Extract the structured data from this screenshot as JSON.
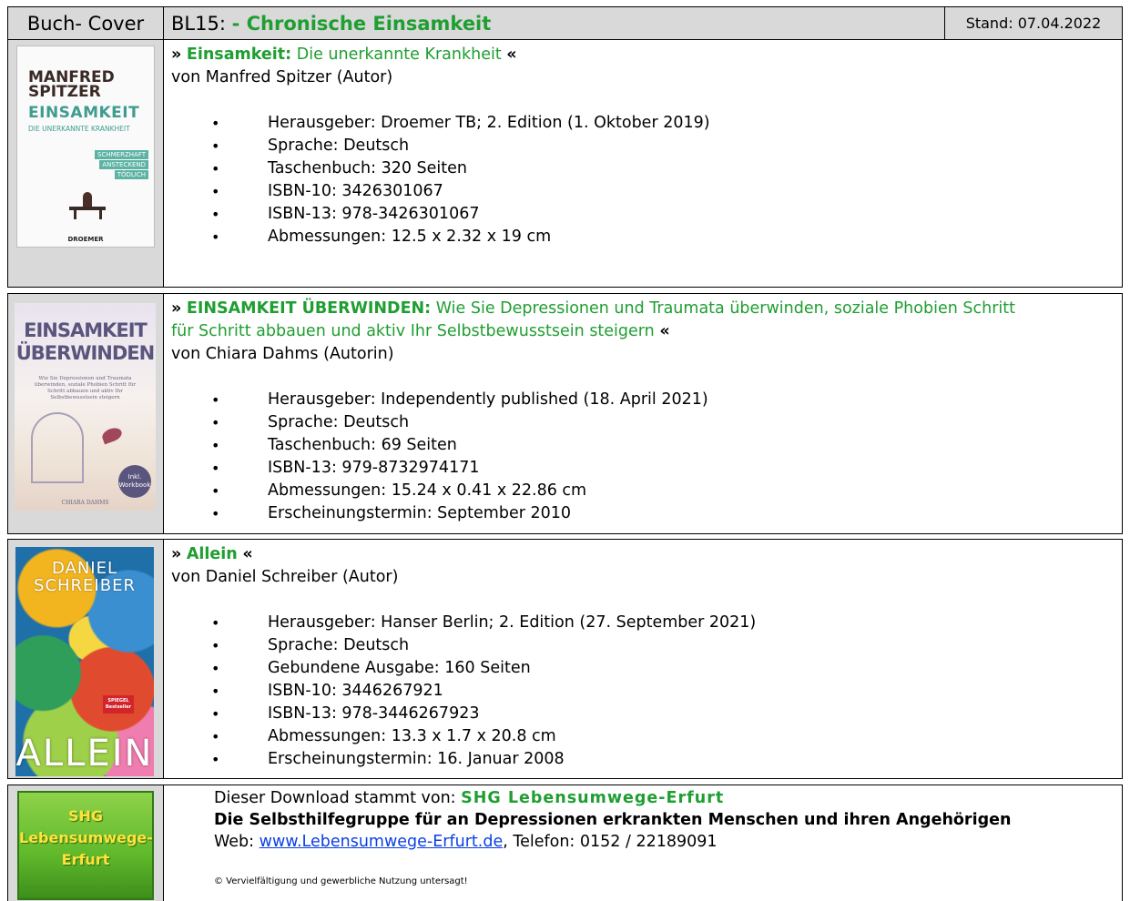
{
  "header": {
    "cover_label": "Buch- Cover",
    "code": "BL15:",
    "title": "- Chronische Einsamkeit",
    "stand": "Stand: 07.04.2022"
  },
  "quote_open": "»",
  "quote_close": "«",
  "books": [
    {
      "title": "Einsamkeit:",
      "subtitle": "Die unerkannte Krankheit",
      "author_line": "von Manfred Spitzer (Autor)",
      "cover": {
        "author": "MANFRED SPITZER",
        "title": "EINSAMKEIT",
        "subtitle": "DIE UNERKANNTE KRANKHEIT",
        "tags": [
          "SCHMERZHAFT",
          "ANSTECKEND",
          "TÖDLICH"
        ],
        "publisher": "DROEMER"
      },
      "facts": [
        "Herausgeber:  Droemer TB; 2. Edition (1. Oktober 2019)",
        "Sprache:  Deutsch",
        "Taschenbuch:  320 Seiten",
        "ISBN-10:  3426301067",
        "ISBN-13:  978-3426301067",
        "Abmessungen:  12.5 x 2.32 x 19 cm"
      ]
    },
    {
      "title": "EINSAMKEIT ÜBERWINDEN:",
      "subtitle_line1": "Wie Sie Depressionen und Traumata überwinden, soziale Phobien Schritt",
      "subtitle_line2": "für Schritt abbauen und aktiv Ihr Selbstbewusstsein steigern",
      "author_line": "von Chiara Dahms (Autorin)",
      "cover": {
        "title_line1": "EINSAMKEIT",
        "title_line2": "ÜBERWINDEN",
        "blurb": "Wie Sie Depressionen und Traumata überwinden, soziale Phobien Schritt für Schritt abbauen und aktiv Ihr Selbstbewusstsein steigern",
        "badge": "Inkl. Workbook",
        "author": "CHIARA DAHMS"
      },
      "facts": [
        "Herausgeber:  Independently published (18. April 2021)",
        "Sprache:  Deutsch",
        "Taschenbuch:  69 Seiten",
        "ISBN-13:  979-8732974171",
        "Abmessungen:  15.24 x 0.41 x 22.86 cm",
        "Erscheinungstermin: September 2010"
      ]
    },
    {
      "title": "Allein",
      "author_line": "von Daniel Schreiber (Autor)",
      "cover": {
        "author_line1": "DANIEL",
        "author_line2": "SCHREIBER",
        "sticker": "SPIEGEL Bestseller",
        "title": "ALLEIN"
      },
      "facts": [
        "Herausgeber:  Hanser Berlin; 2. Edition (27. September 2021)",
        "Sprache:  Deutsch",
        "Gebundene Ausgabe:  160 Seiten",
        "ISBN-10:  3446267921",
        "ISBN-13:  978-3446267923",
        "Abmessungen:  13.3 x 1.7 x 20.8 cm",
        "Erscheinungstermin: 16. Januar 2008"
      ]
    }
  ],
  "footer": {
    "logo_lines": [
      "SHG",
      "Lebensumwege-",
      "Erfurt"
    ],
    "download_text": "Dieser Download stammt von:",
    "shg_name": "SHG Lebensumwege-Erfurt",
    "tagline": "Die Selbsthilfegruppe für an Depressionen erkrankten Menschen und ihren Angehörigen",
    "web_label": "Web:",
    "web_link": "www.Lebensumwege-Erfurt.de",
    "phone": ", Telefon: 0152 / 22189091",
    "copyright": "© Vervielfältigung und gewerbliche Nutzung untersagt!"
  },
  "colors": {
    "green": "#1f9e31",
    "header_bg": "#d9d9d9",
    "link": "#0b3fe6"
  }
}
